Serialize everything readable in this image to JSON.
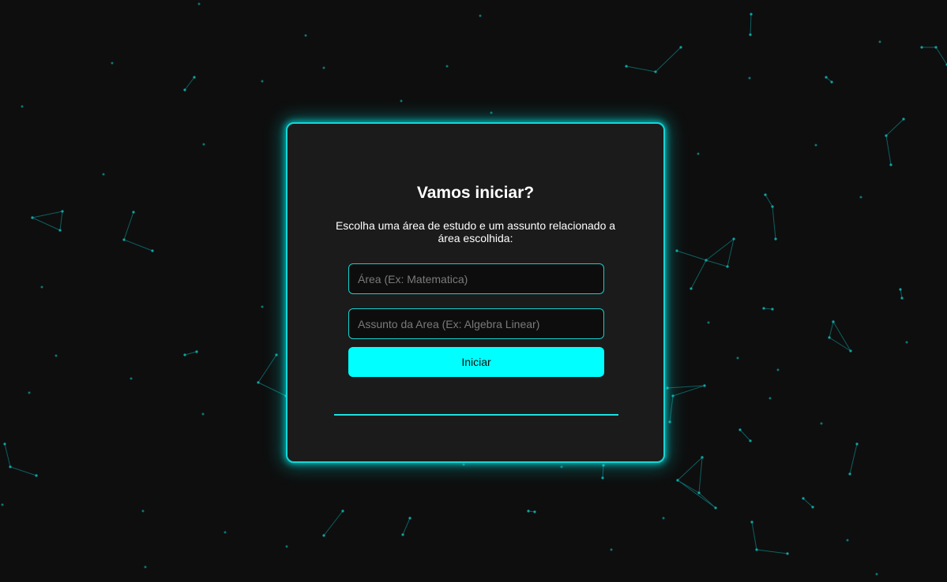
{
  "form": {
    "title": "Vamos iniciar?",
    "subtitle": "Escolha uma área de estudo e um assunto relacionado a área escolhida:",
    "area_placeholder": "Área (Ex: Matematica)",
    "subject_placeholder": "Assunto da Area (Ex: Algebra Linear)",
    "start_label": "Iniciar"
  },
  "colors": {
    "background": "#0e0e0e",
    "card": "#1b1b1b",
    "accent": "#00ffff",
    "network": "#0fa3a3"
  }
}
